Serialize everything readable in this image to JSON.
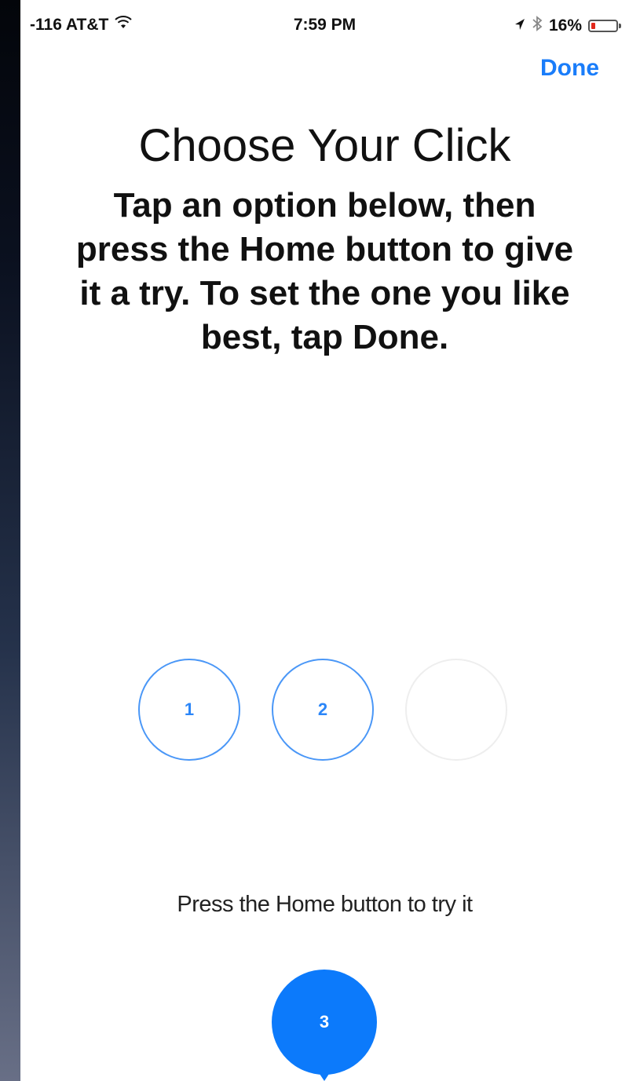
{
  "status_bar": {
    "signal": "-116 AT&T",
    "wifi_icon": "wifi-icon",
    "time": "7:59 PM",
    "location_icon": "location-arrow-icon",
    "bluetooth_icon": "bluetooth-icon",
    "battery_percent": "16%",
    "battery_level": 0.16,
    "battery_color": "#e0271b"
  },
  "nav": {
    "done_label": "Done",
    "accent_color": "#1a7dfa"
  },
  "content": {
    "title": "Choose Your Click",
    "instructions": "Tap an option below, then press the Home button to give it a try. To set the one you like best, tap Done."
  },
  "options": [
    {
      "label": "1",
      "selected": false
    },
    {
      "label": "2",
      "selected": false
    },
    {
      "label": "",
      "selected": false
    },
    {
      "label": "3",
      "selected": true
    }
  ],
  "hint": {
    "text": "Press the Home button to try it"
  }
}
